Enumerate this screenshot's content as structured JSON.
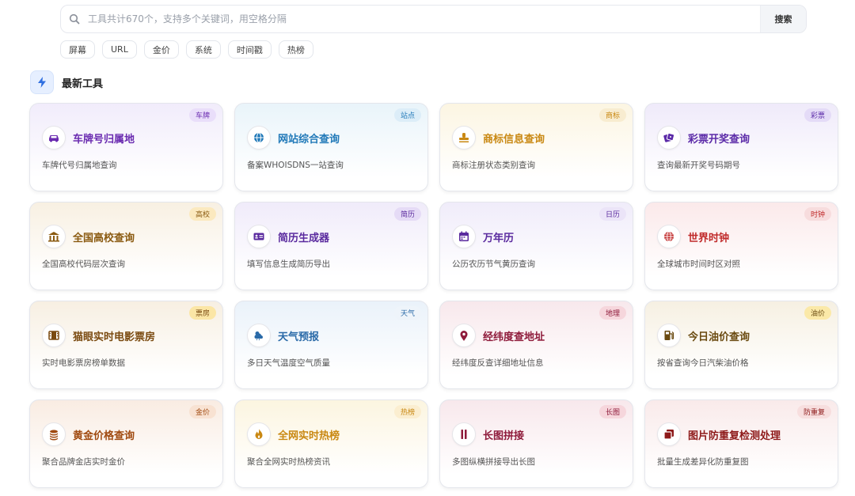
{
  "search": {
    "placeholder": "工具共计670个，支持多个关键词，用空格分隔",
    "button_label": "搜索"
  },
  "tags": [
    "屏幕",
    "URL",
    "金价",
    "系统",
    "时间戳",
    "热榜"
  ],
  "section": {
    "title": "最新工具",
    "icon": "lightning-icon"
  },
  "cards": [
    {
      "title": "车牌号归属地",
      "desc": "车牌代号归属地查询",
      "badge": "车牌",
      "icon": "car-icon",
      "color": "#6a2bb0",
      "bg": "#f1ecfb",
      "badge_bg": "#e9defa"
    },
    {
      "title": "网站综合查询",
      "desc": "备案WHOISDNS一站查询",
      "badge": "站点",
      "icon": "globe-icon",
      "color": "#1f78b8",
      "bg": "#e9f4fa",
      "badge_bg": "#dcedf8"
    },
    {
      "title": "商标信息查询",
      "desc": "商标注册状态类别查询",
      "badge": "商标",
      "icon": "stamp-icon",
      "color": "#c98812",
      "bg": "#fcf5e2",
      "badge_bg": "#f8ecd0"
    },
    {
      "title": "彩票开奖查询",
      "desc": "查询最新开奖号码期号",
      "badge": "彩票",
      "icon": "ticket-icon",
      "color": "#5b2aa8",
      "bg": "#efeafa",
      "badge_bg": "#e4dbf7"
    },
    {
      "title": "全国高校查询",
      "desc": "全国高校代码层次查询",
      "badge": "高校",
      "icon": "university-icon",
      "color": "#8a5a10",
      "bg": "#f8f0e2",
      "badge_bg": "#fbe9bf"
    },
    {
      "title": "简历生成器",
      "desc": "填写信息生成简历导出",
      "badge": "简历",
      "icon": "id-card-icon",
      "color": "#5a2a9e",
      "bg": "#f0ebfa",
      "badge_bg": "#e5dbf6"
    },
    {
      "title": "万年历",
      "desc": "公历农历节气黄历查询",
      "badge": "日历",
      "icon": "calendar-icon",
      "color": "#5a2a9e",
      "bg": "#f0ecfa",
      "badge_bg": "#ebe4f8"
    },
    {
      "title": "世界时钟",
      "desc": "全球城市时间时区对照",
      "badge": "时钟",
      "icon": "world-clock-icon",
      "color": "#c02a2a",
      "bg": "#fbe9ea",
      "badge_bg": "#f7dcdd"
    },
    {
      "title": "猫眼实时电影票房",
      "desc": "实时电影票房榜单数据",
      "badge": "票房",
      "icon": "film-icon",
      "color": "#7a4a10",
      "bg": "#f7efe2",
      "badge_bg": "#fbe6a6"
    },
    {
      "title": "天气预报",
      "desc": "多日天气温度空气质量",
      "badge": "天气",
      "icon": "cloud-sun-icon",
      "color": "#2a6aa8",
      "bg": "#eaf2fa",
      "badge_bg": "#eef4fa"
    },
    {
      "title": "经纬度查地址",
      "desc": "经纬度反查详细地址信息",
      "badge": "地理",
      "icon": "map-pin-icon",
      "color": "#8e1a3a",
      "bg": "#f8e8ec",
      "badge_bg": "#f6d6dc"
    },
    {
      "title": "今日油价查询",
      "desc": "按省查询今日汽柴油价格",
      "badge": "油价",
      "icon": "fuel-icon",
      "color": "#6a4a10",
      "bg": "#f6f0e2",
      "badge_bg": "#fbe9a8"
    },
    {
      "title": "黄金价格查询",
      "desc": "聚合品牌金店实时金价",
      "badge": "金价",
      "icon": "coins-icon",
      "color": "#a04a10",
      "bg": "#f9ece2",
      "badge_bg": "#f8e2d2"
    },
    {
      "title": "全网实时热榜",
      "desc": "聚合全网实时热榜资讯",
      "badge": "热榜",
      "icon": "fire-icon",
      "color": "#c98812",
      "bg": "#fcf5e0",
      "badge_bg": "#fbeed0"
    },
    {
      "title": "长图拼接",
      "desc": "多图纵横拼接导出长图",
      "badge": "长图",
      "icon": "columns-icon",
      "color": "#8e1a3a",
      "bg": "#f8e8ec",
      "badge_bg": "#f6d6dc"
    },
    {
      "title": "图片防重复检测处理",
      "desc": "批量生成差异化防重复图",
      "badge": "防重复",
      "icon": "copy-icon",
      "color": "#8e1a1a",
      "bg": "#f9eaea",
      "badge_bg": "#f7dede"
    }
  ]
}
